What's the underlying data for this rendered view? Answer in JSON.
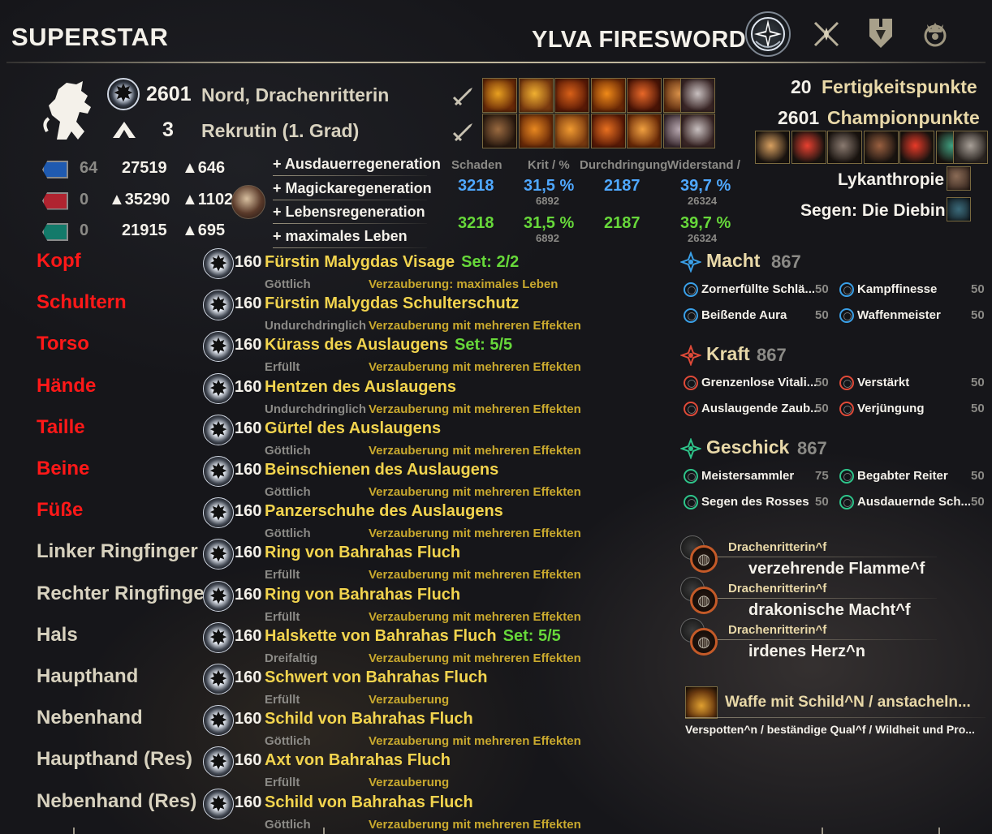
{
  "header": {
    "build_title": "SUPERSTAR",
    "character_name": "YLVA FIRESWORD",
    "category_icons": [
      "champion-star-icon",
      "crossed-blades-icon",
      "guild-crest-icon",
      "crowned-dragon-icon"
    ]
  },
  "character": {
    "alliance_icon": "lion-rampant-icon",
    "champion_points": "2601",
    "race_class": "Nord, Drachenritterin",
    "rank_number": "3",
    "rank_title": "Rekrutin (1. Grad)"
  },
  "skill_bars": {
    "bar_icons": [
      "weapon-swap-icon-1",
      "weapon-swap-icon-2"
    ],
    "front": [
      "flame-lash",
      "shield-throw",
      "spear-shards",
      "fiery-breath",
      "volcanic-rune",
      "molten-whip"
    ],
    "front_ultimate": "dragon-leap",
    "back": [
      "ferocious-bellow",
      "talons",
      "flame-burst",
      "inferno",
      "fire-orb",
      "wrecking-blow"
    ],
    "back_ultimate": "standard-of-might"
  },
  "points": {
    "skill_points_value": "20",
    "skill_points_label": "Fertigkeitspunkte",
    "champion_points_value": "2601",
    "champion_points_label": "Championpunkte"
  },
  "werewolf_row": [
    "werewolf-1",
    "werewolf-2",
    "werewolf-3",
    "werewolf-4",
    "werewolf-5",
    "werewolf-6"
  ],
  "buffs": {
    "vampirism_label": "Lykanthropie",
    "mundus_label": "Segen: Die Diebin"
  },
  "resources": [
    {
      "name": "magicka",
      "attr": "64",
      "max": "27519",
      "regen": "▲646",
      "color": "#1f5ab0"
    },
    {
      "name": "health",
      "attr": "0",
      "max": "▲35290",
      "regen": "▲1102",
      "color": "#b02430"
    },
    {
      "name": "stamina",
      "attr": "0",
      "max": "21915",
      "regen": "▲695",
      "color": "#137a6a"
    }
  ],
  "food_icon": "food-buff-icon",
  "attr_bonuses": [
    "+ Ausdauerregeneration",
    "+ Magickaregeneration",
    "+ Lebensregeneration",
    "+ maximales Leben"
  ],
  "stats": {
    "headers": [
      "Schaden",
      "Krit / %",
      "Durchdringung",
      "Widerstand /"
    ],
    "spell": {
      "damage": "3218",
      "crit": "31,5 %",
      "crit_sub": "6892",
      "pen": "2187",
      "res": "39,7 %",
      "res_sub": "26324"
    },
    "weapon": {
      "damage": "3218",
      "crit": "31,5 %",
      "crit_sub": "6892",
      "pen": "2187",
      "res": "39,7 %",
      "res_sub": "26324"
    }
  },
  "equipment": [
    {
      "slot": "Kopf",
      "slot_color": "red",
      "level": "160",
      "name": "Fürstin Malygdas Visage",
      "set": "Set: 2/2",
      "trait": "Göttlich",
      "enchant": "Verzauberung: maximales Leben"
    },
    {
      "slot": "Schultern",
      "slot_color": "red",
      "level": "160",
      "name": "Fürstin Malygdas Schulterschutz",
      "set": "",
      "trait": "Undurchdringlich",
      "enchant": "Verzauberung mit mehreren Effekten"
    },
    {
      "slot": "Torso",
      "slot_color": "red",
      "level": "160",
      "name": "Kürass des Auslaugens",
      "set": "Set: 5/5",
      "trait": "Erfüllt",
      "enchant": "Verzauberung mit mehreren Effekten"
    },
    {
      "slot": "Hände",
      "slot_color": "red",
      "level": "160",
      "name": "Hentzen des Auslaugens",
      "set": "",
      "trait": "Undurchdringlich",
      "enchant": "Verzauberung mit mehreren Effekten"
    },
    {
      "slot": "Taille",
      "slot_color": "red",
      "level": "160",
      "name": "Gürtel des Auslaugens",
      "set": "",
      "trait": "Göttlich",
      "enchant": "Verzauberung mit mehreren Effekten"
    },
    {
      "slot": "Beine",
      "slot_color": "red",
      "level": "160",
      "name": "Beinschienen des Auslaugens",
      "set": "",
      "trait": "Göttlich",
      "enchant": "Verzauberung mit mehreren Effekten"
    },
    {
      "slot": "Füße",
      "slot_color": "red",
      "level": "160",
      "name": "Panzerschuhe des Auslaugens",
      "set": "",
      "trait": "Göttlich",
      "enchant": "Verzauberung mit mehreren Effekten"
    },
    {
      "slot": "Linker Ringfinger",
      "slot_color": "beige",
      "level": "160",
      "name": "Ring von Bahrahas Fluch",
      "set": "",
      "trait": "Erfüllt",
      "enchant": "Verzauberung mit mehreren Effekten"
    },
    {
      "slot": "Rechter Ringfinger",
      "slot_color": "beige",
      "level": "160",
      "name": "Ring von Bahrahas Fluch",
      "set": "",
      "trait": "Erfüllt",
      "enchant": "Verzauberung mit mehreren Effekten"
    },
    {
      "slot": "Hals",
      "slot_color": "beige",
      "level": "160",
      "name": "Halskette von Bahrahas Fluch",
      "set": "Set: 5/5",
      "trait": "Dreifaltig",
      "enchant": "Verzauberung mit mehreren Effekten"
    },
    {
      "slot": "Haupthand",
      "slot_color": "beige",
      "level": "160",
      "name": "Schwert von Bahrahas Fluch",
      "set": "",
      "trait": "Erfüllt",
      "enchant": "Verzauberung"
    },
    {
      "slot": "Nebenhand",
      "slot_color": "beige",
      "level": "160",
      "name": "Schild von Bahrahas Fluch",
      "set": "",
      "trait": "Göttlich",
      "enchant": "Verzauberung mit mehreren Effekten"
    },
    {
      "slot": "Haupthand (Res)",
      "slot_color": "beige",
      "level": "160",
      "name": "Axt von Bahrahas Fluch",
      "set": "",
      "trait": "Erfüllt",
      "enchant": "Verzauberung"
    },
    {
      "slot": "Nebenhand (Res)",
      "slot_color": "beige",
      "level": "160",
      "name": "Schild von Bahrahas Fluch",
      "set": "",
      "trait": "Göttlich",
      "enchant": "Verzauberung mit mehreren Effekten"
    }
  ],
  "constellations": [
    {
      "name": "Macht",
      "points": "867",
      "color": "#3aa0e8",
      "icon": "mage-constellation-icon",
      "stars": [
        {
          "name": "Zornerfüllte Schlä...",
          "value": "50"
        },
        {
          "name": "Kampffinesse",
          "value": "50"
        },
        {
          "name": "Beißende Aura",
          "value": "50"
        },
        {
          "name": "Waffenmeister",
          "value": "50"
        }
      ]
    },
    {
      "name": "Kraft",
      "points": "867",
      "color": "#e04a38",
      "icon": "warrior-constellation-icon",
      "stars": [
        {
          "name": "Grenzenlose Vitali...",
          "value": "50"
        },
        {
          "name": "Verstärkt",
          "value": "50"
        },
        {
          "name": "Auslaugende Zaub...",
          "value": "50"
        },
        {
          "name": "Verjüngung",
          "value": "50"
        }
      ]
    },
    {
      "name": "Geschick",
      "points": "867",
      "color": "#2ec48a",
      "icon": "thief-constellation-icon",
      "stars": [
        {
          "name": "Meistersammler",
          "value": "75"
        },
        {
          "name": "Begabter Reiter",
          "value": "50"
        },
        {
          "name": "Segen des Rosses",
          "value": "50"
        },
        {
          "name": "Ausdauernde Sch...",
          "value": "50"
        }
      ]
    }
  ],
  "class_passives": [
    {
      "line": "Drachenritterin^f",
      "name": "verzehrende Flamme^f"
    },
    {
      "line": "Drachenritterin^f",
      "name": "drakonische Macht^f"
    },
    {
      "line": "Drachenritterin^f",
      "name": "irdenes Herz^n"
    }
  ],
  "weapon_passive": {
    "title": "Waffe mit Schild^N / anstacheln...",
    "list": "Verspotten^n / beständige Qual^f / Wildheit und Pro..."
  }
}
